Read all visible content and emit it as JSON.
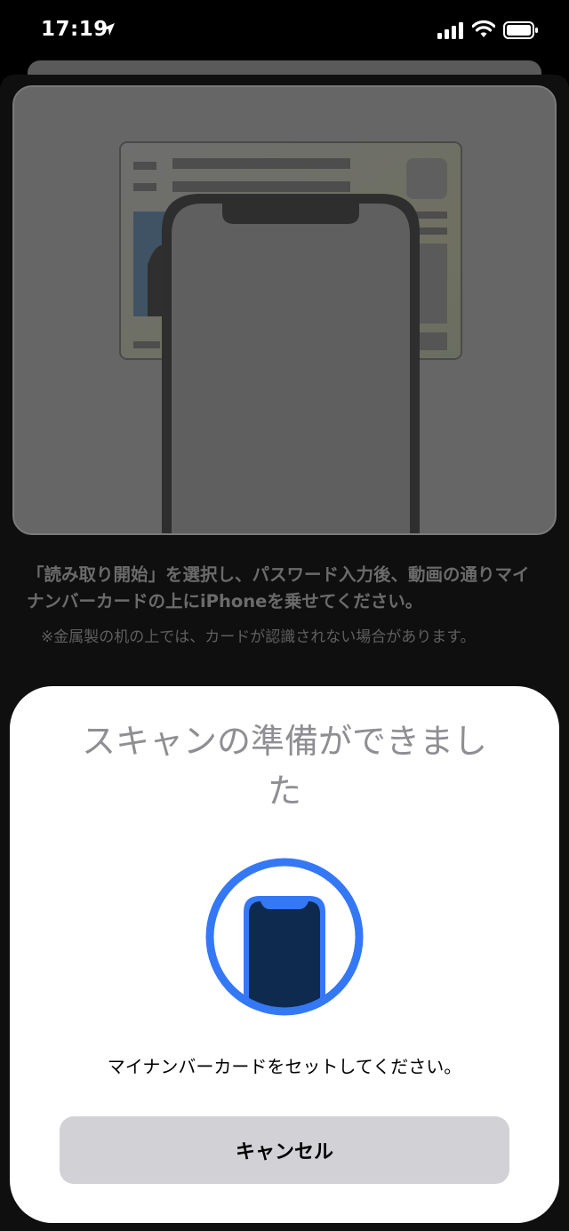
{
  "status_bar": {
    "time": "17:19",
    "location_icon": "location-arrow-icon",
    "signal_icon": "cellular-signal-icon",
    "wifi_icon": "wifi-icon",
    "battery_icon": "battery-icon"
  },
  "background": {
    "illustration": "mynumber-card-with-iphone",
    "instruction": "「読み取り開始」を選択し、パスワード入力後、動画の通りマイナンバーカードの上にiPhoneを乗せてください。",
    "note": "※金属製の机の上では、カードが認識されない場合があります。"
  },
  "scan_sheet": {
    "title": "スキャンの準備ができました",
    "icon": "phone-scan-icon",
    "message": "マイナンバーカードをセットしてください。",
    "cancel_label": "キャンセル"
  },
  "colors": {
    "accent": "#3478f6",
    "phone_fill": "#0e2a4e",
    "button_bg": "#d1d1d6"
  }
}
